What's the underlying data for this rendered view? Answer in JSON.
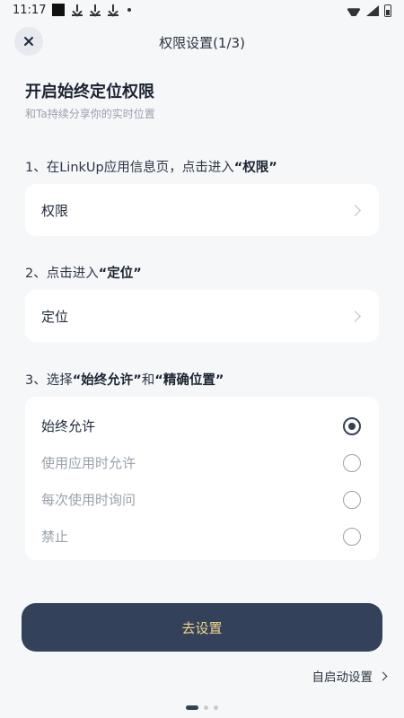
{
  "status": {
    "time": "11:17"
  },
  "nav": {
    "title_prefix": "权限设置(1/",
    "title_num": "3",
    "title_suffix": ")"
  },
  "intro": {
    "heading": "开启始终定位权限",
    "subheading": "和Ta持续分享你的实时位置"
  },
  "steps": [
    {
      "prefix": "1、在LinkUp应用信息页，点击进入",
      "highlight": "“权限”",
      "card_label": "权限"
    },
    {
      "prefix": "2、点击进入",
      "highlight": "“定位”",
      "card_label": "定位"
    }
  ],
  "step3": {
    "prefix": "3、选择",
    "hl1": "“始终允许”",
    "mid": "和",
    "hl2": "“精确位置”"
  },
  "options": [
    {
      "label": "始终允许",
      "selected": true
    },
    {
      "label": "使用应用时允许",
      "selected": false
    },
    {
      "label": "每次使用时询问",
      "selected": false
    },
    {
      "label": "禁止",
      "selected": false
    }
  ],
  "actions": {
    "primary": "去设置",
    "secondary": "自启动设置"
  },
  "colors": {
    "primary_bg": "#33415a",
    "primary_text": "#f2d48c",
    "accent": "#344156"
  },
  "pager": {
    "count": 3,
    "current": 1
  }
}
